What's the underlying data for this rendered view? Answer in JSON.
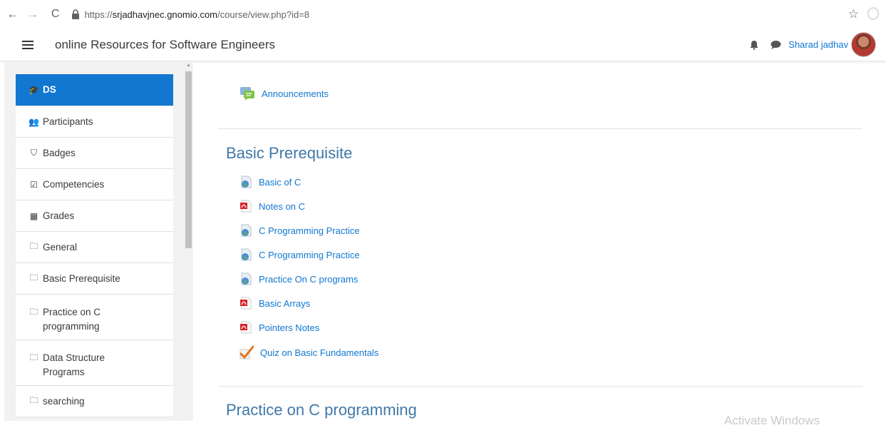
{
  "browser": {
    "url_prefix": "https://",
    "url_host": "srjadhavjnec.gnomio.com",
    "url_path": "/course/view.php?id=8",
    "back_icon": "←",
    "forward_icon": "→",
    "reload_icon": "C",
    "star_icon": "☆"
  },
  "navbar": {
    "site_title": "online Resources for Software Engineers",
    "user_name": "Sharad jadhav"
  },
  "sidebar": {
    "items": [
      {
        "label": "DS",
        "icon": "graduation-cap-icon",
        "glyph": "🎓"
      },
      {
        "label": "Participants",
        "icon": "users-icon",
        "glyph": "👥"
      },
      {
        "label": "Badges",
        "icon": "shield-icon",
        "glyph": "⛉"
      },
      {
        "label": "Competencies",
        "icon": "checkbox-icon",
        "glyph": "☑"
      },
      {
        "label": "Grades",
        "icon": "table-icon",
        "glyph": "▦"
      },
      {
        "label": "General",
        "icon": "folder-icon",
        "glyph": "🗀"
      },
      {
        "label": "Basic Prerequisite",
        "icon": "folder-icon",
        "glyph": "🗀"
      },
      {
        "label": "Practice on C programming",
        "icon": "folder-icon",
        "glyph": "🗀"
      },
      {
        "label": "Data Structure Programs",
        "icon": "folder-icon",
        "glyph": "🗀"
      },
      {
        "label": "searching",
        "icon": "folder-icon",
        "glyph": "🗀"
      }
    ]
  },
  "main": {
    "announcements": {
      "label": "Announcements",
      "icon": "forum-icon"
    },
    "sections": [
      {
        "title": "Basic Prerequisite",
        "activities": [
          {
            "label": "Basic of C",
            "icon": "url-globe-icon"
          },
          {
            "label": "Notes on C",
            "icon": "pdf-icon"
          },
          {
            "label": "C Programming Practice",
            "icon": "url-globe-icon"
          },
          {
            "label": "C Programming Practice",
            "icon": "url-globe-icon"
          },
          {
            "label": "Practice On C programs",
            "icon": "url-globe-icon"
          },
          {
            "label": "Basic Arrays",
            "icon": "pdf-icon"
          },
          {
            "label": "Pointers Notes",
            "icon": "pdf-icon"
          },
          {
            "label": "Quiz on Basic Fundamentals",
            "icon": "quiz-checkmark-icon"
          }
        ]
      },
      {
        "title": "Practice on C programming",
        "activities": []
      }
    ],
    "watermark": "Activate Windows"
  },
  "colors": {
    "link": "#1177d1",
    "section_title": "#3f78a8",
    "active_sidebar": "#1177d1"
  }
}
